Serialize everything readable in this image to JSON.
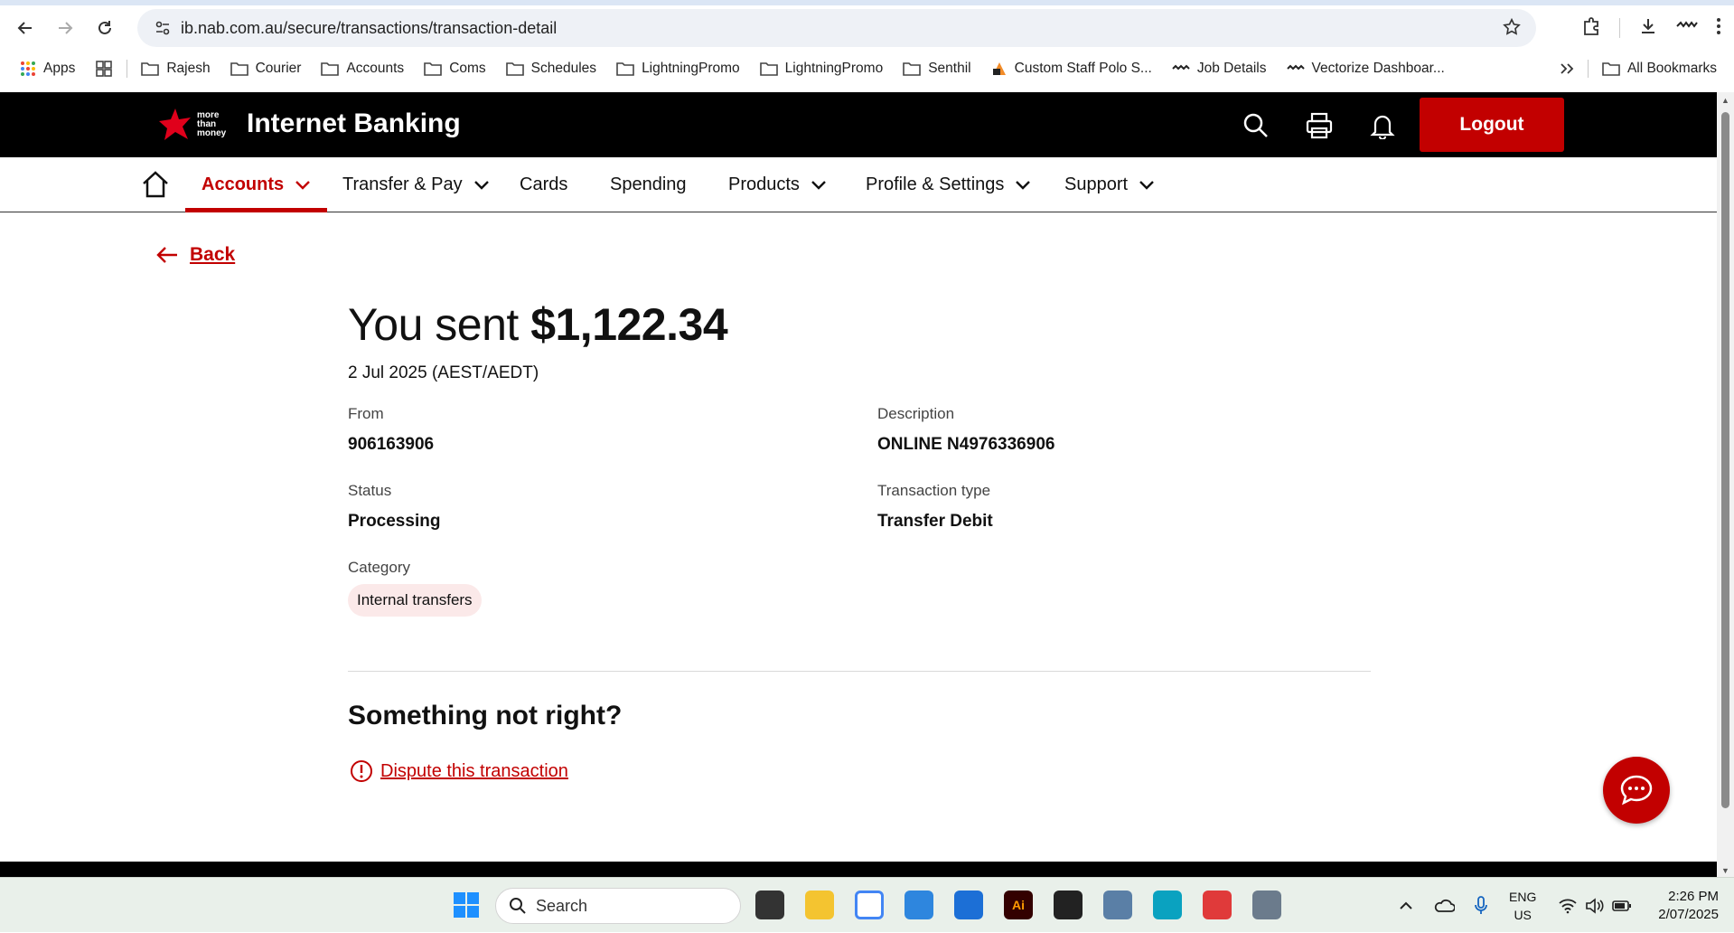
{
  "browser": {
    "url": "ib.nab.com.au/secure/transactions/transaction-detail",
    "bookmarks": [
      {
        "label": "Apps",
        "icon": "apps-grid-icon"
      },
      {
        "label": "Rajesh",
        "icon": "folder-icon"
      },
      {
        "label": "Courier",
        "icon": "folder-icon"
      },
      {
        "label": "Accounts",
        "icon": "folder-icon"
      },
      {
        "label": "Coms",
        "icon": "folder-icon"
      },
      {
        "label": "Schedules",
        "icon": "folder-icon"
      },
      {
        "label": "LightningPromo",
        "icon": "folder-icon"
      },
      {
        "label": "LightningPromo",
        "icon": "folder-icon"
      },
      {
        "label": "Senthil",
        "icon": "folder-icon"
      },
      {
        "label": "Custom Staff Polo S...",
        "icon": "site-icon"
      },
      {
        "label": "Job Details",
        "icon": "site-icon"
      },
      {
        "label": "Vectorize Dashboar...",
        "icon": "site-icon"
      }
    ],
    "all_bookmarks": "All Bookmarks"
  },
  "header": {
    "logo_tagline": [
      "more",
      "than",
      "money"
    ],
    "title": "Internet Banking",
    "logout": "Logout"
  },
  "nav": {
    "items": [
      "Accounts",
      "Transfer & Pay",
      "Cards",
      "Spending",
      "Products",
      "Profile & Settings",
      "Support"
    ]
  },
  "page": {
    "back": "Back",
    "headline_prefix": "You sent",
    "amount": "$1,122.34",
    "date": "2 Jul 2025 (AEST/AEDT)",
    "from_label": "From",
    "from_value": "906163906",
    "description_label": "Description",
    "description_value": "ONLINE N4976336906",
    "status_label": "Status",
    "status_value": "Processing",
    "type_label": "Transaction type",
    "type_value": "Transfer Debit",
    "category_label": "Category",
    "category_value": "Internal transfers",
    "problem_heading": "Something not right?",
    "dispute_link": "Dispute this transaction"
  },
  "taskbar": {
    "search": "Search",
    "lang_line1": "ENG",
    "lang_line2": "US",
    "time": "2:26 PM",
    "date": "2/07/2025"
  },
  "colors": {
    "brand_red": "#c20000",
    "header_black": "#000000"
  }
}
